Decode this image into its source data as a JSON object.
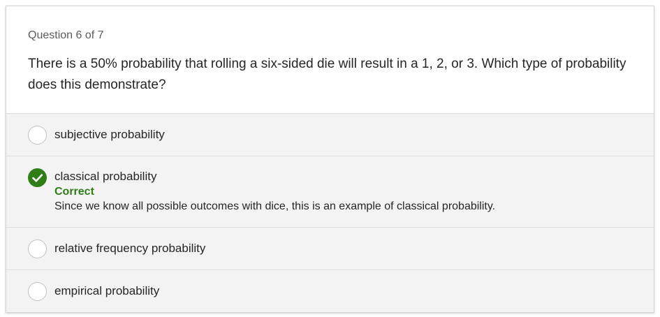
{
  "quiz": {
    "counter": "Question 6 of 7",
    "question": "There is a 50% probability that rolling a six-sided die will result in a 1, 2, or 3. Which type of probability does this demonstrate?",
    "options": [
      {
        "label": "subjective probability",
        "selected": false
      },
      {
        "label": "classical probability",
        "selected": true,
        "feedback_title": "Correct",
        "feedback_text": "Since we know all possible outcomes with dice, this is an example of classical probability."
      },
      {
        "label": "relative frequency probability",
        "selected": false
      },
      {
        "label": "empirical probability",
        "selected": false
      }
    ]
  },
  "colors": {
    "correct": "#2e7d17",
    "option_background": "#f3f3f3",
    "divider": "#dddddd"
  },
  "icons": {
    "correct": "checkmark-circle-icon",
    "unselected": "radio-empty-icon"
  }
}
